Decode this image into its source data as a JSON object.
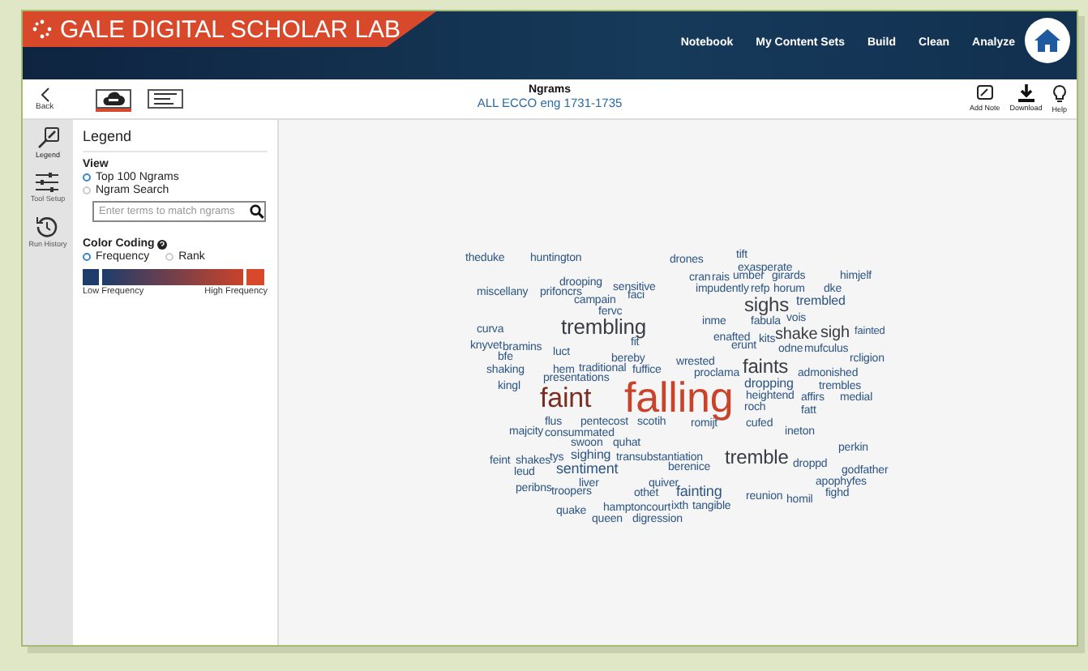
{
  "app": {
    "title": "GALE DIGITAL SCHOLAR LAB",
    "nav": [
      {
        "label": "Notebook"
      },
      {
        "label": "My Content Sets"
      },
      {
        "label": "Build"
      },
      {
        "label": "Clean"
      },
      {
        "label": "Analyze"
      }
    ]
  },
  "toolbar": {
    "back": "Back",
    "views": [
      {
        "kind": "cloud",
        "selected": true
      },
      {
        "kind": "list",
        "selected": false
      }
    ],
    "title": "Ngrams",
    "subtitle": "ALL ECCO eng 1731-1735",
    "actions": [
      {
        "kind": "note",
        "label": "Add Note"
      },
      {
        "kind": "download",
        "label": "Download"
      },
      {
        "kind": "help",
        "label": "Help"
      }
    ]
  },
  "rail": [
    {
      "kind": "legend",
      "label": "Legend",
      "selected": true
    },
    {
      "kind": "setup",
      "label": "Tool Setup",
      "selected": false
    },
    {
      "kind": "history",
      "label": "Run History",
      "selected": false
    }
  ],
  "legend": {
    "title": "Legend",
    "view_heading": "View",
    "view_options": [
      {
        "label": "Top 100 Ngrams",
        "selected": true
      },
      {
        "label": "Ngram Search",
        "selected": false
      }
    ],
    "search": {
      "placeholder": "Enter terms to match ngrams"
    },
    "color_heading": "Color Coding",
    "color_options": [
      {
        "label": "Frequency",
        "selected": true
      },
      {
        "label": "Rank",
        "selected": false
      }
    ],
    "low_label": "Low Frequency",
    "high_label": "High Frequency"
  },
  "words": [
    {
      "text": "theduke",
      "color": "#2d5583"
    },
    {
      "text": "huntington",
      "color": "#2d5583"
    },
    {
      "text": "drones",
      "color": "#2d5583"
    },
    {
      "text": "tift",
      "color": "#2d5583"
    },
    {
      "text": "exasperate",
      "color": "#2d5583"
    },
    {
      "text": "cran",
      "color": "#2d5583"
    },
    {
      "text": "rais",
      "color": "#2d5583"
    },
    {
      "text": "umber",
      "color": "#2d5583"
    },
    {
      "text": "girards",
      "color": "#2d5583"
    },
    {
      "text": "himjelf",
      "color": "#2d5583"
    },
    {
      "text": "miscellany",
      "color": "#2d5583"
    },
    {
      "text": "drooping",
      "color": "#2d5583"
    },
    {
      "text": "prifoncrs",
      "color": "#2d5583"
    },
    {
      "text": "sensitive",
      "color": "#2d5583"
    },
    {
      "text": "faci",
      "color": "#2d5583"
    },
    {
      "text": "impudently",
      "color": "#2d5583"
    },
    {
      "text": "refp",
      "color": "#2d5583"
    },
    {
      "text": "horum",
      "color": "#2d5583"
    },
    {
      "text": "dke",
      "color": "#2d5583"
    },
    {
      "text": "campain",
      "color": "#2d5583"
    },
    {
      "text": "fervc",
      "color": "#2d5583"
    },
    {
      "text": "sighs",
      "color": "#3b3d45"
    },
    {
      "text": "trembled",
      "color": "#2d5583"
    },
    {
      "text": "curva",
      "color": "#2d5583"
    },
    {
      "text": "trembling",
      "color": "#3b3d45"
    },
    {
      "text": "inme",
      "color": "#2d5583"
    },
    {
      "text": "fabula",
      "color": "#2d5583"
    },
    {
      "text": "vois",
      "color": "#2d5583"
    },
    {
      "text": "knyvet",
      "color": "#2d5583"
    },
    {
      "text": "bramins",
      "color": "#2d5583"
    },
    {
      "text": "bfe",
      "color": "#2d5583"
    },
    {
      "text": "luct",
      "color": "#2d5583"
    },
    {
      "text": "fit",
      "color": "#2d5583"
    },
    {
      "text": "enafted",
      "color": "#2d5583"
    },
    {
      "text": "kits",
      "color": "#2d5583"
    },
    {
      "text": "shake",
      "color": "#3b3d45"
    },
    {
      "text": "sigh",
      "color": "#3b3d45"
    },
    {
      "text": "fainted",
      "color": "#2d5583"
    },
    {
      "text": "erunt",
      "color": "#2d5583"
    },
    {
      "text": "odne",
      "color": "#2d5583"
    },
    {
      "text": "mufculus",
      "color": "#2d5583"
    },
    {
      "text": "bereby",
      "color": "#2d5583"
    },
    {
      "text": "wrested",
      "color": "#2d5583"
    },
    {
      "text": "rcligion",
      "color": "#2d5583"
    },
    {
      "text": "shaking",
      "color": "#2d5583"
    },
    {
      "text": "hem",
      "color": "#2d5583"
    },
    {
      "text": "traditional",
      "color": "#2d5583"
    },
    {
      "text": "fuffice",
      "color": "#2d5583"
    },
    {
      "text": "proclama",
      "color": "#2d5583"
    },
    {
      "text": "faints",
      "color": "#3b3d45"
    },
    {
      "text": "admonished",
      "color": "#2d5583"
    },
    {
      "text": "presentations",
      "color": "#2d5583"
    },
    {
      "text": "kingl",
      "color": "#2d5583"
    },
    {
      "text": "faint",
      "color": "#7a2e22"
    },
    {
      "text": "falling",
      "color": "#c9432a"
    },
    {
      "text": "dropping",
      "color": "#2d5583"
    },
    {
      "text": "trembles",
      "color": "#2d5583"
    },
    {
      "text": "heightend",
      "color": "#2d5583"
    },
    {
      "text": "affirs",
      "color": "#2d5583"
    },
    {
      "text": "medial",
      "color": "#2d5583"
    },
    {
      "text": "flus",
      "color": "#2d5583"
    },
    {
      "text": "pentecost",
      "color": "#2d5583"
    },
    {
      "text": "scotih",
      "color": "#2d5583"
    },
    {
      "text": "roch",
      "color": "#2d5583"
    },
    {
      "text": "fatt",
      "color": "#2d5583"
    },
    {
      "text": "romijt",
      "color": "#2d5583"
    },
    {
      "text": "cufed",
      "color": "#2d5583"
    },
    {
      "text": "majcity",
      "color": "#2d5583"
    },
    {
      "text": "consummated",
      "color": "#2d5583"
    },
    {
      "text": "ineton",
      "color": "#2d5583"
    },
    {
      "text": "swoon",
      "color": "#2d5583"
    },
    {
      "text": "quhat",
      "color": "#2d5583"
    },
    {
      "text": "perkin",
      "color": "#2d5583"
    },
    {
      "text": "feint",
      "color": "#2d5583"
    },
    {
      "text": "shakes",
      "color": "#2d5583"
    },
    {
      "text": "tys",
      "color": "#2d5583"
    },
    {
      "text": "sighing",
      "color": "#2d5583"
    },
    {
      "text": "transubstantiation",
      "color": "#2d5583"
    },
    {
      "text": "tremble",
      "color": "#3b3d45"
    },
    {
      "text": "berenice",
      "color": "#2d5583"
    },
    {
      "text": "droppd",
      "color": "#2d5583"
    },
    {
      "text": "leud",
      "color": "#2d5583"
    },
    {
      "text": "sentiment",
      "color": "#2d5583"
    },
    {
      "text": "godfather",
      "color": "#2d5583"
    },
    {
      "text": "liver",
      "color": "#2d5583"
    },
    {
      "text": "quiver",
      "color": "#2d5583"
    },
    {
      "text": "apophyfes",
      "color": "#2d5583"
    },
    {
      "text": "peribns",
      "color": "#2d5583"
    },
    {
      "text": "troopers",
      "color": "#2d5583"
    },
    {
      "text": "othet",
      "color": "#2d5583"
    },
    {
      "text": "fainting",
      "color": "#2d5583"
    },
    {
      "text": "reunion",
      "color": "#2d5583"
    },
    {
      "text": "homil",
      "color": "#2d5583"
    },
    {
      "text": "fighd",
      "color": "#2d5583"
    },
    {
      "text": "hamptoncourt",
      "color": "#2d5583"
    },
    {
      "text": "ixth",
      "color": "#2d5583"
    },
    {
      "text": "tangible",
      "color": "#2d5583"
    },
    {
      "text": "quake",
      "color": "#2d5583"
    },
    {
      "text": "queen",
      "color": "#2d5583"
    },
    {
      "text": "digression",
      "color": "#2d5583"
    }
  ]
}
